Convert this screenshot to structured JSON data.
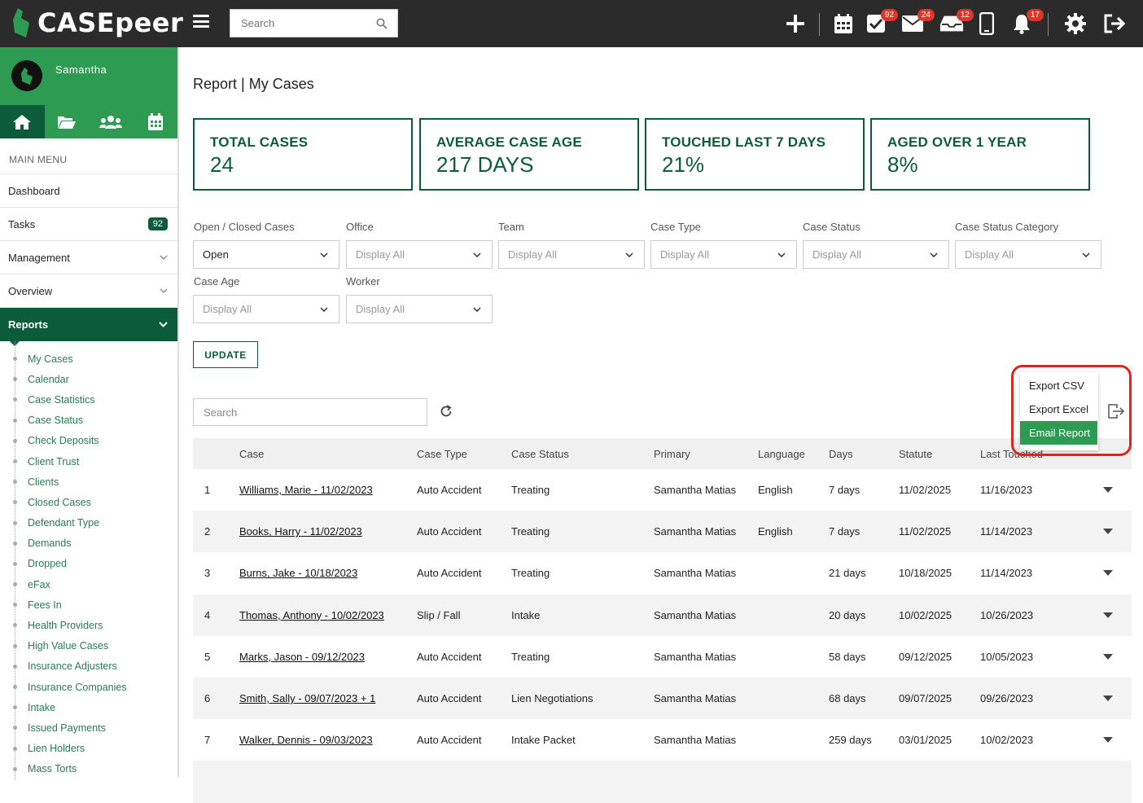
{
  "app": {
    "name": "CASEpeer"
  },
  "topbar": {
    "search_placeholder": "Search",
    "badges": {
      "tasks": "92",
      "mail": "24",
      "inbox": "12",
      "notifications": "17"
    }
  },
  "sidebar": {
    "user": "Samantha",
    "main_menu_label": "MAIN MENU",
    "items": [
      {
        "label": "Dashboard"
      },
      {
        "label": "Tasks",
        "badge": "92"
      },
      {
        "label": "Management"
      },
      {
        "label": "Overview"
      },
      {
        "label": "Reports"
      }
    ],
    "reports": [
      "My Cases",
      "Calendar",
      "Case Statistics",
      "Case Status",
      "Check Deposits",
      "Client Trust",
      "Clients",
      "Closed Cases",
      "Defendant Type",
      "Demands",
      "Dropped",
      "eFax",
      "Fees In",
      "Health Providers",
      "High Value Cases",
      "Insurance Adjusters",
      "Insurance Companies",
      "Intake",
      "Issued Payments",
      "Lien Holders",
      "Mass Torts"
    ]
  },
  "page": {
    "title": "Report | My Cases"
  },
  "stats": [
    {
      "label": "TOTAL CASES",
      "value": "24"
    },
    {
      "label": "AVERAGE CASE AGE",
      "value": "217 DAYS"
    },
    {
      "label": "TOUCHED LAST 7 DAYS",
      "value": "21%"
    },
    {
      "label": "AGED OVER 1 YEAR",
      "value": "8%"
    }
  ],
  "filters": [
    {
      "label": "Open / Closed Cases",
      "value": "Open"
    },
    {
      "label": "Office",
      "value": "Display All"
    },
    {
      "label": "Team",
      "value": "Display All"
    },
    {
      "label": "Case Type",
      "value": "Display All"
    },
    {
      "label": "Case Status",
      "value": "Display All"
    },
    {
      "label": "Case Status Category",
      "value": "Display All"
    },
    {
      "label": "Case Age",
      "value": "Display All"
    },
    {
      "label": "Worker",
      "value": "Display All"
    }
  ],
  "update_label": "UPDATE",
  "table_search_placeholder": "Search",
  "export_menu": {
    "csv": "Export CSV",
    "excel": "Export Excel",
    "email": "Email Report"
  },
  "table": {
    "headers": {
      "case": "Case",
      "case_type": "Case Type",
      "case_status": "Case Status",
      "primary": "Primary",
      "language": "Language",
      "days": "Days",
      "statute": "Statute",
      "last_touched": "Last Touched"
    },
    "rows": [
      {
        "n": "1",
        "case": "Williams, Marie - 11/02/2023",
        "type": "Auto Accident",
        "status": "Treating",
        "primary": "Samantha Matias",
        "language": "English",
        "days": "7 days",
        "statute": "11/02/2025",
        "last": "11/16/2023"
      },
      {
        "n": "2",
        "case": "Books, Harry - 11/02/2023",
        "type": "Auto Accident",
        "status": "Treating",
        "primary": "Samantha Matias",
        "language": "English",
        "days": "7 days",
        "statute": "11/02/2025",
        "last": "11/14/2023"
      },
      {
        "n": "3",
        "case": "Burns, Jake - 10/18/2023",
        "type": "Auto Accident",
        "status": "Treating",
        "primary": "Samantha Matias",
        "language": "",
        "days": "21 days",
        "statute": "10/18/2025",
        "last": "11/14/2023"
      },
      {
        "n": "4",
        "case": "Thomas, Anthony - 10/02/2023",
        "type": "Slip / Fall",
        "status": "Intake",
        "primary": "Samantha Matias",
        "language": "",
        "days": "20 days",
        "statute": "10/02/2025",
        "last": "10/26/2023"
      },
      {
        "n": "5",
        "case": "Marks, Jason - 09/12/2023",
        "type": "Auto Accident",
        "status": "Treating",
        "primary": "Samantha Matias",
        "language": "",
        "days": "58 days",
        "statute": "09/12/2025",
        "last": "10/05/2023"
      },
      {
        "n": "6",
        "case": "Smith, Sally - 09/07/2023 + 1",
        "type": "Auto Accident",
        "status": "Lien Negotiations",
        "primary": "Samantha Matias",
        "language": "",
        "days": "68 days",
        "statute": "09/07/2025",
        "last": "09/26/2023"
      },
      {
        "n": "7",
        "case": "Walker, Dennis - 09/03/2023",
        "type": "Auto Accident",
        "status": "Intake Packet",
        "primary": "Samantha Matias",
        "language": "",
        "days": "259 days",
        "statute": "03/01/2025",
        "last": "10/02/2023"
      }
    ]
  }
}
